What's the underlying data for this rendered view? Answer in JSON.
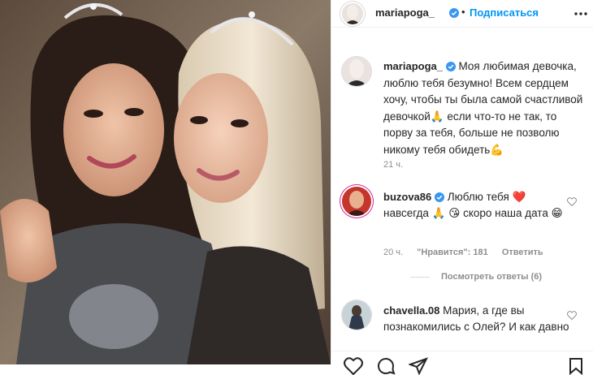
{
  "post": {
    "username": "mariapoga_",
    "follow_label": "Подписаться",
    "more_icon": "more-horizontal-icon"
  },
  "caption": {
    "username": "mariapoga_",
    "text": "Моя любимая девочка, люблю тебя безумно! Всем сердцем хочу, чтобы ты была самой счастливой девочкой🙏 если что-то не так, то порву за тебя, больше не позволю никому тебя обидеть💪",
    "time": "21 ч."
  },
  "comments": [
    {
      "username": "buzova86",
      "text": "Люблю тебя ❤️ навсегда 🙏 😘 скоро наша дата 😁",
      "time": "20 ч.",
      "likes": "\"Нравится\": 181",
      "reply": "Ответить",
      "view_replies": "Посмотреть ответы (6)"
    },
    {
      "username": "chavella.08",
      "text": "Мария, а где вы познакомились с Олей? И как давно"
    }
  ],
  "colors": {
    "link_blue": "#0095f6",
    "verified_blue": "#3897f0",
    "muted": "#8e8e8e",
    "heart_red": "#ed4956"
  }
}
